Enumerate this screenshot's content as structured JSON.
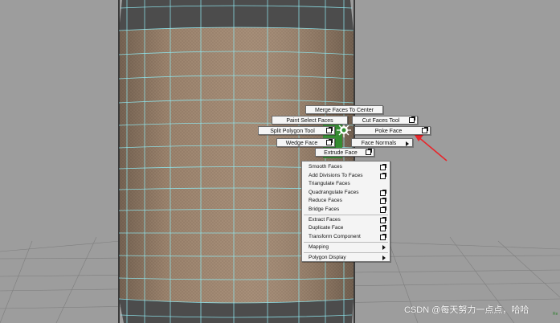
{
  "marking_menu": {
    "north": "Merge Faces To Center",
    "north_west": "Paint Select Faces",
    "north_east": "Cut Faces Tool",
    "west": "Split Polygon Tool",
    "east": "Poke Face",
    "south_west": "Wedge Face",
    "south_east": "Face Normals",
    "south": "Extrude Face"
  },
  "overflow_menu": {
    "items": [
      {
        "label": "Smooth Faces",
        "options": true
      },
      {
        "label": "Add Divisions To Faces",
        "options": true
      },
      {
        "label": "Triangulate Faces",
        "options": false
      },
      {
        "label": "Quadrangulate Faces",
        "options": true
      },
      {
        "label": "Reduce Faces",
        "options": true
      },
      {
        "label": "Bridge Faces",
        "options": true
      },
      {
        "label": "Extract Faces",
        "options": true
      },
      {
        "label": "Duplicate Face",
        "options": true
      },
      {
        "label": "Transform Component",
        "options": true
      },
      {
        "label": "Mapping",
        "submenu": true
      },
      {
        "label": "Polygon Display",
        "submenu": true
      }
    ]
  },
  "watermark": "CSDN @每天努力一点点，哈哈",
  "colors": {
    "viewport_bg": "#9d9d9d",
    "mesh_face": "#a38a73",
    "mesh_dark": "#4c4c4c",
    "wire": "#8fe8f0",
    "annotation_arrow": "#e8262b"
  }
}
